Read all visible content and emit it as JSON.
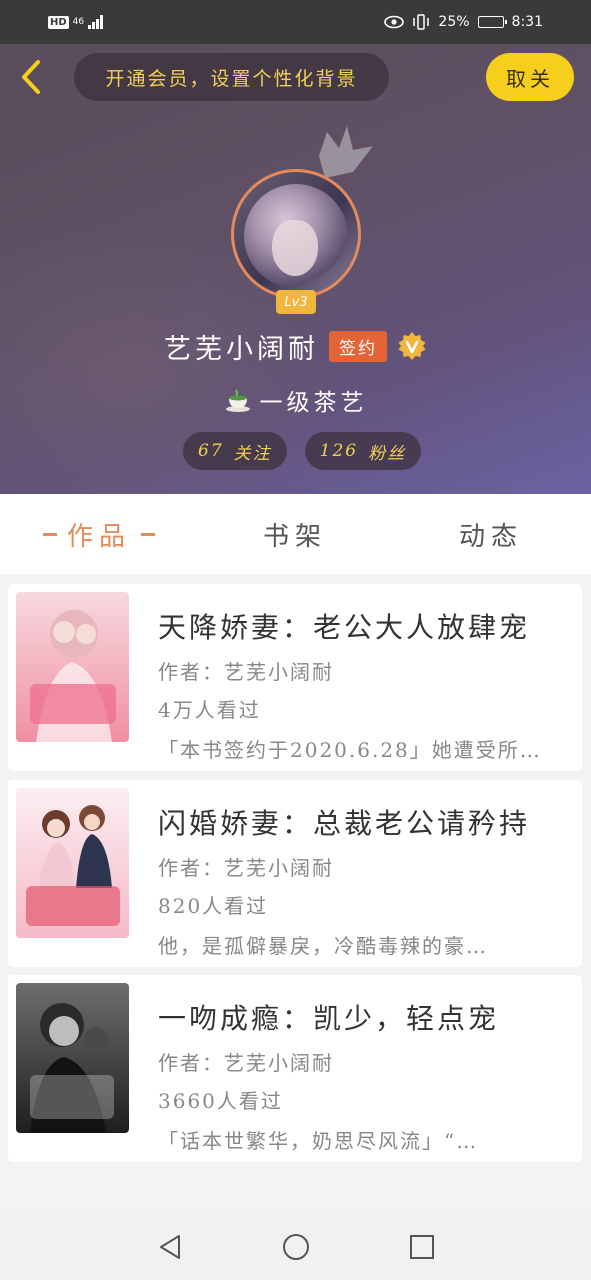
{
  "status_bar": {
    "hd": "HD",
    "network": "46",
    "battery_text": "25%",
    "battery_level": 0.25,
    "time": "8:31"
  },
  "header": {
    "vip_prompt": "开通会员，设置个性化背景",
    "cancel_label": "取关",
    "level": "Lv3",
    "user_name": "艺芜小阔耐",
    "signed_badge": "签约",
    "tea_rank": "一级茶艺",
    "stats": {
      "follow_count": "67",
      "follow_label": "关注",
      "fans_count": "126",
      "fans_label": "粉丝"
    }
  },
  "tabs": [
    {
      "label": "作品",
      "active": true
    },
    {
      "label": "书架",
      "active": false
    },
    {
      "label": "动态",
      "active": false
    }
  ],
  "books": [
    {
      "title": "天降娇妻：老公大人放肆宠",
      "author": "作者：艺芜小阔耐",
      "views": "4万人看过",
      "desc": "「本书签约于2020.6.28」她遭受所…"
    },
    {
      "title": "闪婚娇妻：总裁老公请矜持",
      "author": "作者：艺芜小阔耐",
      "views": "820人看过",
      "desc": "他，是孤僻暴戾，冷酷毒辣的豪…"
    },
    {
      "title": "一吻成瘾：凯少，轻点宠",
      "author": "作者：艺芜小阔耐",
      "views": "3660人看过",
      "desc": "「话本世繁华，奶思尽风流」“…"
    }
  ],
  "colors": {
    "accent": "#e58a5b",
    "vip_gold": "#f3cf56",
    "cancel_yellow": "#f5cf1c",
    "signed_orange": "#e56436"
  }
}
